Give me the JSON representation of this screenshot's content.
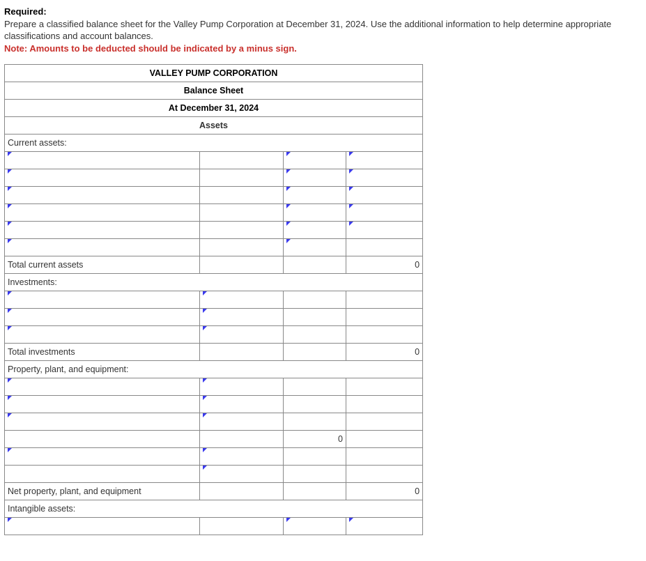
{
  "intro": {
    "required_label": "Required:",
    "body": "Prepare a classified balance sheet for the Valley Pump Corporation at December 31, 2024. Use the additional information to help determine appropriate classifications and account balances.",
    "note": "Note: Amounts to be deducted should be indicated by a minus sign."
  },
  "sheet": {
    "corp": "VALLEY PUMP CORPORATION",
    "title": "Balance Sheet",
    "date": "At December 31, 2024",
    "section": "Assets",
    "labels": {
      "current_assets": "Current assets:",
      "total_current_assets": "Total current assets",
      "investments": "Investments:",
      "total_investments": "Total investments",
      "ppe": "Property, plant, and equipment:",
      "net_ppe": "Net property, plant, and equipment",
      "intangible": "Intangible assets:"
    },
    "vals": {
      "total_current_assets": "0",
      "total_investments": "0",
      "ppe_subtotal": "0",
      "net_ppe": "0"
    }
  }
}
